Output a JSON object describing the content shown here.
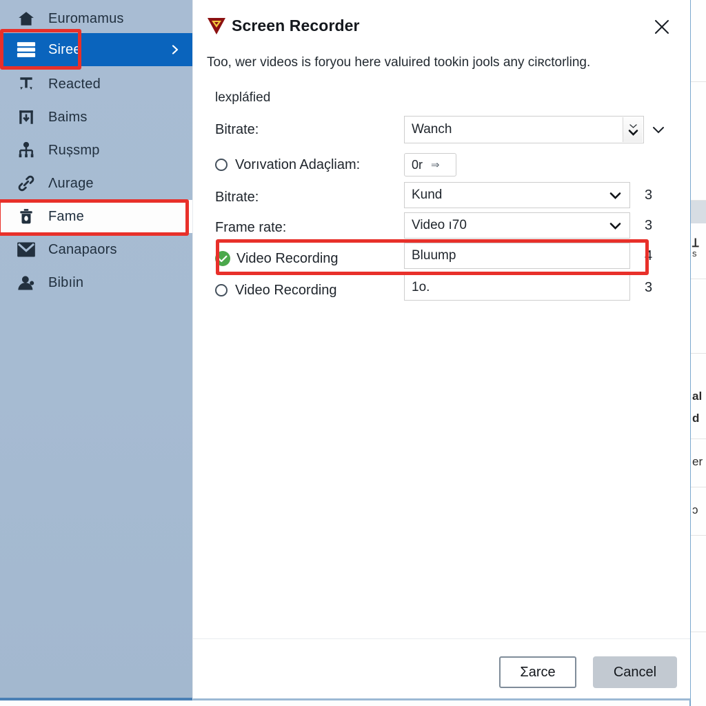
{
  "sidebar": {
    "items": [
      {
        "label": "Euromamus",
        "icon": "home-icon",
        "selected": false,
        "highlighted": false
      },
      {
        "label": "Siree",
        "icon": "server-list-icon",
        "selected": true,
        "highlighted": false,
        "chevron": "›"
      },
      {
        "label": "Reacted",
        "icon": "anchor-icon",
        "selected": false,
        "highlighted": false
      },
      {
        "label": "Baims",
        "icon": "download-icon",
        "selected": false,
        "highlighted": false
      },
      {
        "label": "Rușsmp",
        "icon": "sitemap-icon",
        "selected": false,
        "highlighted": false
      },
      {
        "label": "Ʌurage",
        "icon": "link-icon",
        "selected": false,
        "highlighted": false
      },
      {
        "label": "Fame",
        "icon": "trash-icon",
        "selected": false,
        "highlighted": true
      },
      {
        "label": "Canapaors",
        "icon": "envelope-icon",
        "selected": false,
        "highlighted": false
      },
      {
        "label": "Bibıin",
        "icon": "user-icon",
        "selected": false,
        "highlighted": false
      }
    ]
  },
  "dialog": {
    "title": "Screen Recorder",
    "logo_icon": "red-triangle-logo-icon",
    "close_icon": "close-icon",
    "subtitle": "Too, wer videos is foryou here valuired tookin jools any ciʀctorling.",
    "section_label": "Ɩexpláfied",
    "rows": [
      {
        "label": "Bitrate:",
        "control": "spinner",
        "value": "Wanch",
        "number": "",
        "marker": "none",
        "external_caret": true
      },
      {
        "label": "Vorıvation Adaçliam:",
        "control": "smallbox",
        "value": "0r",
        "arrow": "⇒",
        "number": "",
        "marker": "radio"
      },
      {
        "label": "Bitrate:",
        "control": "dropdown",
        "value": "Kund",
        "number": "3",
        "marker": "none"
      },
      {
        "label": "Frame rate:",
        "control": "dropdown",
        "value": "Video ı70",
        "number": "3",
        "marker": "none"
      },
      {
        "label": "Video Recording",
        "control": "textbox",
        "value": "Bluump",
        "number": "4",
        "marker": "check",
        "highlighted": true
      },
      {
        "label": "Video Recording",
        "control": "textbox",
        "value": "1o.",
        "number": "3",
        "marker": "radio"
      }
    ],
    "footer": {
      "save_label": "Ʃarce",
      "cancel_label": "Cancel"
    }
  },
  "background": {
    "fragments": [
      "Ʇ",
      "s",
      "al",
      "d",
      "er",
      "ɔ"
    ]
  },
  "colors": {
    "sidebar_bg": "#a6bbd2",
    "selected_blue": "#0a64bd",
    "highlight_red": "#e8302a",
    "check_green": "#4ba84b",
    "logo_red": "#8c1111",
    "logo_gold": "#f2c63c",
    "cancel_gray": "#c2c9d1"
  }
}
